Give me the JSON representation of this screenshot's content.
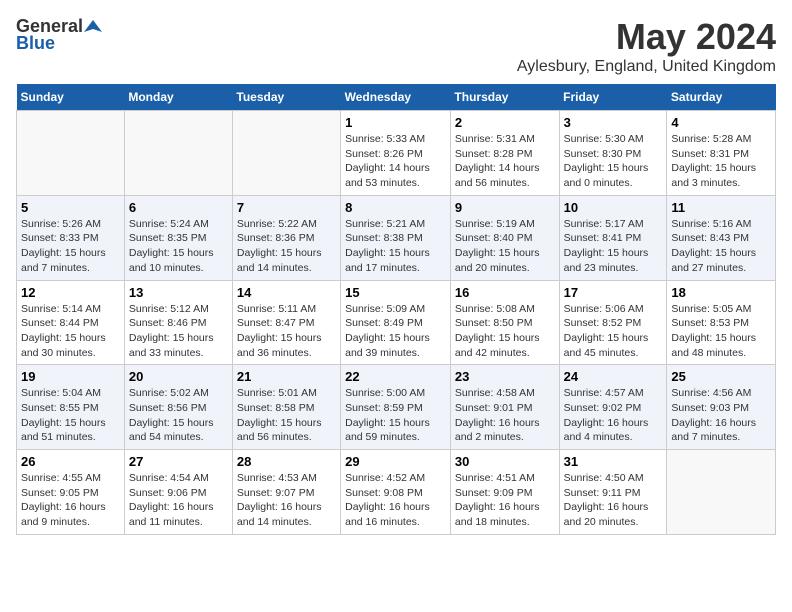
{
  "header": {
    "logo_general": "General",
    "logo_blue": "Blue",
    "month": "May 2024",
    "location": "Aylesbury, England, United Kingdom"
  },
  "days_of_week": [
    "Sunday",
    "Monday",
    "Tuesday",
    "Wednesday",
    "Thursday",
    "Friday",
    "Saturday"
  ],
  "weeks": [
    [
      {
        "day": "",
        "info": ""
      },
      {
        "day": "",
        "info": ""
      },
      {
        "day": "",
        "info": ""
      },
      {
        "day": "1",
        "info": "Sunrise: 5:33 AM\nSunset: 8:26 PM\nDaylight: 14 hours and 53 minutes."
      },
      {
        "day": "2",
        "info": "Sunrise: 5:31 AM\nSunset: 8:28 PM\nDaylight: 14 hours and 56 minutes."
      },
      {
        "day": "3",
        "info": "Sunrise: 5:30 AM\nSunset: 8:30 PM\nDaylight: 15 hours and 0 minutes."
      },
      {
        "day": "4",
        "info": "Sunrise: 5:28 AM\nSunset: 8:31 PM\nDaylight: 15 hours and 3 minutes."
      }
    ],
    [
      {
        "day": "5",
        "info": "Sunrise: 5:26 AM\nSunset: 8:33 PM\nDaylight: 15 hours and 7 minutes."
      },
      {
        "day": "6",
        "info": "Sunrise: 5:24 AM\nSunset: 8:35 PM\nDaylight: 15 hours and 10 minutes."
      },
      {
        "day": "7",
        "info": "Sunrise: 5:22 AM\nSunset: 8:36 PM\nDaylight: 15 hours and 14 minutes."
      },
      {
        "day": "8",
        "info": "Sunrise: 5:21 AM\nSunset: 8:38 PM\nDaylight: 15 hours and 17 minutes."
      },
      {
        "day": "9",
        "info": "Sunrise: 5:19 AM\nSunset: 8:40 PM\nDaylight: 15 hours and 20 minutes."
      },
      {
        "day": "10",
        "info": "Sunrise: 5:17 AM\nSunset: 8:41 PM\nDaylight: 15 hours and 23 minutes."
      },
      {
        "day": "11",
        "info": "Sunrise: 5:16 AM\nSunset: 8:43 PM\nDaylight: 15 hours and 27 minutes."
      }
    ],
    [
      {
        "day": "12",
        "info": "Sunrise: 5:14 AM\nSunset: 8:44 PM\nDaylight: 15 hours and 30 minutes."
      },
      {
        "day": "13",
        "info": "Sunrise: 5:12 AM\nSunset: 8:46 PM\nDaylight: 15 hours and 33 minutes."
      },
      {
        "day": "14",
        "info": "Sunrise: 5:11 AM\nSunset: 8:47 PM\nDaylight: 15 hours and 36 minutes."
      },
      {
        "day": "15",
        "info": "Sunrise: 5:09 AM\nSunset: 8:49 PM\nDaylight: 15 hours and 39 minutes."
      },
      {
        "day": "16",
        "info": "Sunrise: 5:08 AM\nSunset: 8:50 PM\nDaylight: 15 hours and 42 minutes."
      },
      {
        "day": "17",
        "info": "Sunrise: 5:06 AM\nSunset: 8:52 PM\nDaylight: 15 hours and 45 minutes."
      },
      {
        "day": "18",
        "info": "Sunrise: 5:05 AM\nSunset: 8:53 PM\nDaylight: 15 hours and 48 minutes."
      }
    ],
    [
      {
        "day": "19",
        "info": "Sunrise: 5:04 AM\nSunset: 8:55 PM\nDaylight: 15 hours and 51 minutes."
      },
      {
        "day": "20",
        "info": "Sunrise: 5:02 AM\nSunset: 8:56 PM\nDaylight: 15 hours and 54 minutes."
      },
      {
        "day": "21",
        "info": "Sunrise: 5:01 AM\nSunset: 8:58 PM\nDaylight: 15 hours and 56 minutes."
      },
      {
        "day": "22",
        "info": "Sunrise: 5:00 AM\nSunset: 8:59 PM\nDaylight: 15 hours and 59 minutes."
      },
      {
        "day": "23",
        "info": "Sunrise: 4:58 AM\nSunset: 9:01 PM\nDaylight: 16 hours and 2 minutes."
      },
      {
        "day": "24",
        "info": "Sunrise: 4:57 AM\nSunset: 9:02 PM\nDaylight: 16 hours and 4 minutes."
      },
      {
        "day": "25",
        "info": "Sunrise: 4:56 AM\nSunset: 9:03 PM\nDaylight: 16 hours and 7 minutes."
      }
    ],
    [
      {
        "day": "26",
        "info": "Sunrise: 4:55 AM\nSunset: 9:05 PM\nDaylight: 16 hours and 9 minutes."
      },
      {
        "day": "27",
        "info": "Sunrise: 4:54 AM\nSunset: 9:06 PM\nDaylight: 16 hours and 11 minutes."
      },
      {
        "day": "28",
        "info": "Sunrise: 4:53 AM\nSunset: 9:07 PM\nDaylight: 16 hours and 14 minutes."
      },
      {
        "day": "29",
        "info": "Sunrise: 4:52 AM\nSunset: 9:08 PM\nDaylight: 16 hours and 16 minutes."
      },
      {
        "day": "30",
        "info": "Sunrise: 4:51 AM\nSunset: 9:09 PM\nDaylight: 16 hours and 18 minutes."
      },
      {
        "day": "31",
        "info": "Sunrise: 4:50 AM\nSunset: 9:11 PM\nDaylight: 16 hours and 20 minutes."
      },
      {
        "day": "",
        "info": ""
      }
    ]
  ]
}
